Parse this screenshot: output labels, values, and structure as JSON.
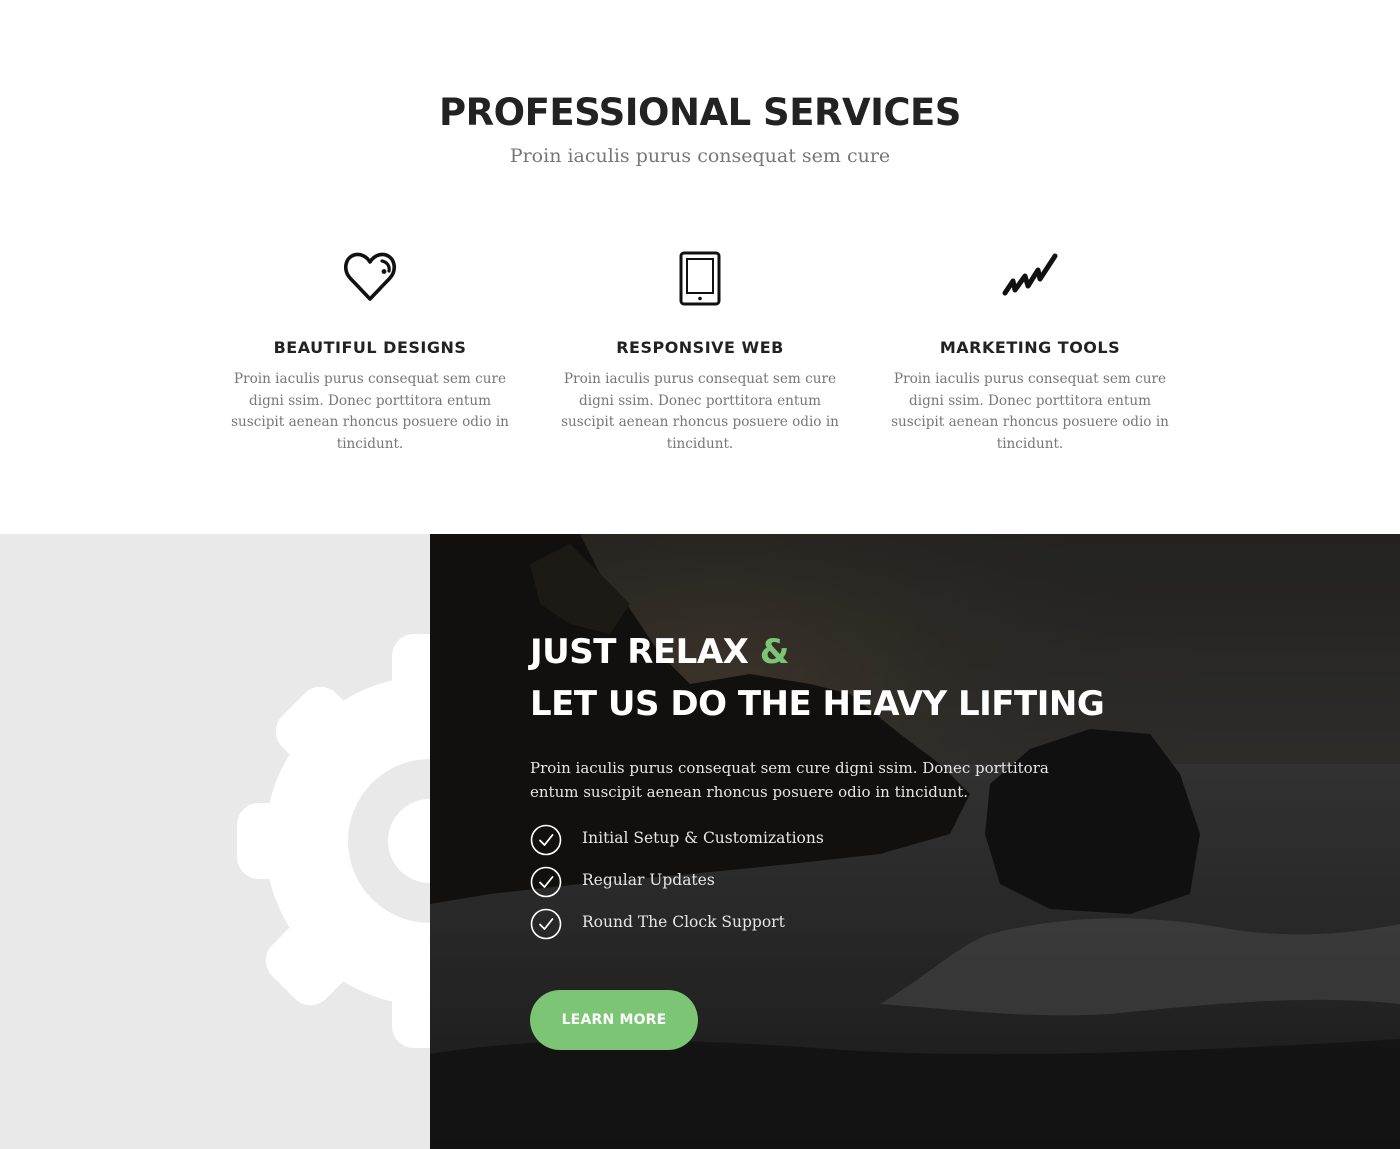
{
  "services": {
    "title": "PROFESSIONAL SERVICES",
    "subtitle": "Proin iaculis purus consequat sem cure",
    "items": [
      {
        "icon": "heart-icon",
        "title": "BEAUTIFUL DESIGNS",
        "text": "Proin iaculis purus consequat sem cure digni ssim. Donec porttitora entum suscipit aenean rhoncus posuere odio in tincidunt."
      },
      {
        "icon": "tablet-icon",
        "title": "RESPONSIVE WEB",
        "text": "Proin iaculis purus consequat sem cure digni ssim. Donec porttitora entum suscipit aenean rhoncus posuere odio in tincidunt."
      },
      {
        "icon": "trend-chart-icon",
        "title": "MARKETING TOOLS",
        "text": "Proin iaculis purus consequat sem cure digni ssim. Donec porttitora entum suscipit aenean rhoncus posuere odio in tincidunt."
      }
    ]
  },
  "relax": {
    "heading_line1": "JUST RELAX",
    "heading_amp": "&",
    "heading_line2": "LET US DO THE HEAVY LIFTING",
    "text": "Proin iaculis purus consequat sem cure  digni ssim. Donec porttitora entum suscipit  aenean rhoncus posuere odio in tincidunt.",
    "features": [
      "Initial Setup & Customizations",
      "Regular Updates",
      "Round The Clock Support"
    ],
    "button_label": "LEARN MORE",
    "decor_icon": "gear-icon",
    "check_icon": "check-circle-icon"
  },
  "colors": {
    "accent": "#7bc575",
    "heading": "#222222",
    "body_text": "#777777",
    "left_panel": "#e9e9e9"
  }
}
